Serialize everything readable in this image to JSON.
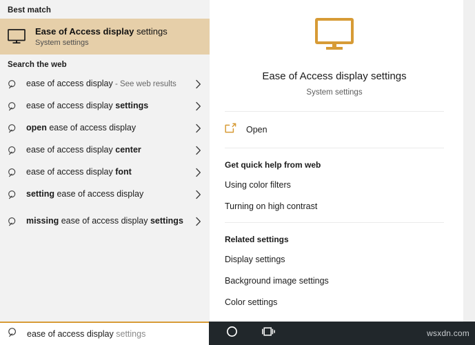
{
  "left_panel": {
    "best_match_header": "Best match",
    "best_match": {
      "icon": "monitor-icon",
      "title_bold": "Ease of Access display",
      "title_regular": " settings",
      "subtitle": "System settings"
    },
    "web_header": "Search the web",
    "web_results": [
      {
        "icon": "search-icon",
        "bold": "",
        "regular": "ease of access display",
        "suffix": " - See web results",
        "bold_tail": "",
        "chevron": "chevron-right-icon"
      },
      {
        "icon": "search-icon",
        "bold": "",
        "regular": "ease of access display ",
        "suffix": "",
        "bold_tail": "settings",
        "chevron": "chevron-right-icon"
      },
      {
        "icon": "search-icon",
        "bold": "open ",
        "regular": "ease of access display",
        "suffix": "",
        "bold_tail": "",
        "chevron": "chevron-right-icon"
      },
      {
        "icon": "search-icon",
        "bold": "",
        "regular": "ease of access display ",
        "suffix": "",
        "bold_tail": "center",
        "chevron": "chevron-right-icon"
      },
      {
        "icon": "search-icon",
        "bold": "",
        "regular": "ease of access display ",
        "suffix": "",
        "bold_tail": "font",
        "chevron": "chevron-right-icon"
      },
      {
        "icon": "search-icon",
        "bold": "setting ",
        "regular": "ease of access display",
        "suffix": "",
        "bold_tail": "",
        "chevron": "chevron-right-icon"
      },
      {
        "icon": "search-icon",
        "bold": "missing ",
        "regular": "ease of access display ",
        "suffix": "",
        "bold_tail": "settings",
        "chevron": "chevron-right-icon"
      }
    ]
  },
  "detail_panel": {
    "hero_icon": "monitor-icon",
    "title": "Ease of Access display settings",
    "subtitle": "System settings",
    "open_action": {
      "icon": "open-external-icon",
      "label": "Open"
    },
    "quick_help": {
      "title": "Get quick help from web",
      "links": [
        "Using color filters",
        "Turning on high contrast"
      ]
    },
    "related": {
      "title": "Related settings",
      "links": [
        "Display settings",
        "Background image settings",
        "Color settings"
      ]
    }
  },
  "taskbar": {
    "search": {
      "icon": "search-icon",
      "value": "ease of access display",
      "ghost_suffix": " settings"
    },
    "buttons": [
      {
        "icon": "cortana-circle-icon",
        "name": "cortana-button"
      },
      {
        "icon": "task-view-icon",
        "name": "task-view-button"
      }
    ],
    "watermark": "wsxdn.com"
  },
  "colors": {
    "accent_orange": "#d79b36",
    "best_match_highlight": "#e6cfa9",
    "left_panel_bg": "#f2f2f2",
    "taskbar_bg": "#21272b"
  }
}
